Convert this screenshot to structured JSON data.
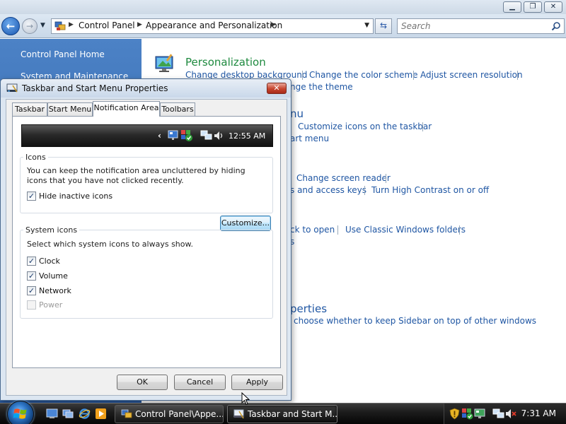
{
  "control_panel": {
    "address": {
      "crumbs": [
        "Control Panel",
        "Appearance and Personalization"
      ]
    },
    "search_placeholder": "Search",
    "sidebar": {
      "home_label": "Control Panel Home",
      "item2_label": "System and Maintenance"
    },
    "content": {
      "personalization_heading": "Personalization",
      "links": [
        "Change desktop background",
        "Change the color scheme",
        "Adjust screen resolution",
        "Change the theme",
        "Taskbar and Start Menu",
        "Customize icons on the taskbar",
        "Customize the Start menu",
        "Change screen reader",
        "Adjust keyboard shortcuts and access keys",
        "Turn High Contrast on or off",
        "Specify single- or double-click to open",
        "Use Classic Windows folders",
        "Show hidden files and folders",
        "Windows Sidebar Properties",
        "Add gadgets to Sidebar or choose whether to keep Sidebar on top of other windows"
      ],
      "visible_fragments": {
        "change_the_theme": "nge the theme",
        "taskbar_heading": "nu",
        "start_menu": "art menu",
        "access_keys": "s and access keys",
        "click_to_open": "ck to open",
        "hidden_files": "s",
        "sidebar_heading": "perties",
        "sidebar_desc": "choose whether to keep Sidebar on top of other windows"
      }
    }
  },
  "dialog": {
    "title": "Taskbar and Start Menu Properties",
    "close_label": "✕",
    "tabs": [
      "Taskbar",
      "Start Menu",
      "Notification Area",
      "Toolbars"
    ],
    "active_tab": "Notification Area",
    "preview_clock": "12:55 AM",
    "icons_group": {
      "legend": "Icons",
      "description": "You can keep the notification area uncluttered by hiding icons that you have not clicked recently.",
      "hide_inactive_label": "Hide inactive icons",
      "hide_inactive_checked": true,
      "customize_label": "Customize..."
    },
    "system_icons_group": {
      "legend": "System icons",
      "description": "Select which system icons to always show.",
      "items": [
        {
          "label": "Clock",
          "checked": true,
          "enabled": true
        },
        {
          "label": "Volume",
          "checked": true,
          "enabled": true
        },
        {
          "label": "Network",
          "checked": true,
          "enabled": true
        },
        {
          "label": "Power",
          "checked": false,
          "enabled": false
        }
      ]
    },
    "buttons": {
      "ok": "OK",
      "cancel": "Cancel",
      "apply": "Apply"
    }
  },
  "taskbar": {
    "tasks": [
      {
        "label": "Control Panel\\Appe..."
      },
      {
        "label": "Taskbar and Start M..."
      }
    ],
    "clock": "7:31 AM"
  },
  "colors": {
    "link_blue": "#1f56a3",
    "heading_green": "#1e8a3f",
    "sidebar_blue": "#2e63a8"
  }
}
